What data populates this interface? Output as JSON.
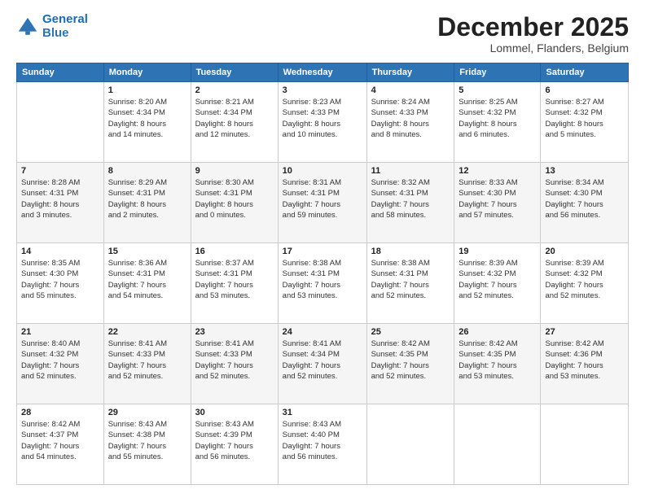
{
  "logo": {
    "line1": "General",
    "line2": "Blue"
  },
  "title": "December 2025",
  "location": "Lommel, Flanders, Belgium",
  "days_of_week": [
    "Sunday",
    "Monday",
    "Tuesday",
    "Wednesday",
    "Thursday",
    "Friday",
    "Saturday"
  ],
  "weeks": [
    [
      {
        "day": "",
        "info": ""
      },
      {
        "day": "1",
        "info": "Sunrise: 8:20 AM\nSunset: 4:34 PM\nDaylight: 8 hours\nand 14 minutes."
      },
      {
        "day": "2",
        "info": "Sunrise: 8:21 AM\nSunset: 4:34 PM\nDaylight: 8 hours\nand 12 minutes."
      },
      {
        "day": "3",
        "info": "Sunrise: 8:23 AM\nSunset: 4:33 PM\nDaylight: 8 hours\nand 10 minutes."
      },
      {
        "day": "4",
        "info": "Sunrise: 8:24 AM\nSunset: 4:33 PM\nDaylight: 8 hours\nand 8 minutes."
      },
      {
        "day": "5",
        "info": "Sunrise: 8:25 AM\nSunset: 4:32 PM\nDaylight: 8 hours\nand 6 minutes."
      },
      {
        "day": "6",
        "info": "Sunrise: 8:27 AM\nSunset: 4:32 PM\nDaylight: 8 hours\nand 5 minutes."
      }
    ],
    [
      {
        "day": "7",
        "info": "Sunrise: 8:28 AM\nSunset: 4:31 PM\nDaylight: 8 hours\nand 3 minutes."
      },
      {
        "day": "8",
        "info": "Sunrise: 8:29 AM\nSunset: 4:31 PM\nDaylight: 8 hours\nand 2 minutes."
      },
      {
        "day": "9",
        "info": "Sunrise: 8:30 AM\nSunset: 4:31 PM\nDaylight: 8 hours\nand 0 minutes."
      },
      {
        "day": "10",
        "info": "Sunrise: 8:31 AM\nSunset: 4:31 PM\nDaylight: 7 hours\nand 59 minutes."
      },
      {
        "day": "11",
        "info": "Sunrise: 8:32 AM\nSunset: 4:31 PM\nDaylight: 7 hours\nand 58 minutes."
      },
      {
        "day": "12",
        "info": "Sunrise: 8:33 AM\nSunset: 4:30 PM\nDaylight: 7 hours\nand 57 minutes."
      },
      {
        "day": "13",
        "info": "Sunrise: 8:34 AM\nSunset: 4:30 PM\nDaylight: 7 hours\nand 56 minutes."
      }
    ],
    [
      {
        "day": "14",
        "info": "Sunrise: 8:35 AM\nSunset: 4:30 PM\nDaylight: 7 hours\nand 55 minutes."
      },
      {
        "day": "15",
        "info": "Sunrise: 8:36 AM\nSunset: 4:31 PM\nDaylight: 7 hours\nand 54 minutes."
      },
      {
        "day": "16",
        "info": "Sunrise: 8:37 AM\nSunset: 4:31 PM\nDaylight: 7 hours\nand 53 minutes."
      },
      {
        "day": "17",
        "info": "Sunrise: 8:38 AM\nSunset: 4:31 PM\nDaylight: 7 hours\nand 53 minutes."
      },
      {
        "day": "18",
        "info": "Sunrise: 8:38 AM\nSunset: 4:31 PM\nDaylight: 7 hours\nand 52 minutes."
      },
      {
        "day": "19",
        "info": "Sunrise: 8:39 AM\nSunset: 4:32 PM\nDaylight: 7 hours\nand 52 minutes."
      },
      {
        "day": "20",
        "info": "Sunrise: 8:39 AM\nSunset: 4:32 PM\nDaylight: 7 hours\nand 52 minutes."
      }
    ],
    [
      {
        "day": "21",
        "info": "Sunrise: 8:40 AM\nSunset: 4:32 PM\nDaylight: 7 hours\nand 52 minutes."
      },
      {
        "day": "22",
        "info": "Sunrise: 8:41 AM\nSunset: 4:33 PM\nDaylight: 7 hours\nand 52 minutes."
      },
      {
        "day": "23",
        "info": "Sunrise: 8:41 AM\nSunset: 4:33 PM\nDaylight: 7 hours\nand 52 minutes."
      },
      {
        "day": "24",
        "info": "Sunrise: 8:41 AM\nSunset: 4:34 PM\nDaylight: 7 hours\nand 52 minutes."
      },
      {
        "day": "25",
        "info": "Sunrise: 8:42 AM\nSunset: 4:35 PM\nDaylight: 7 hours\nand 52 minutes."
      },
      {
        "day": "26",
        "info": "Sunrise: 8:42 AM\nSunset: 4:35 PM\nDaylight: 7 hours\nand 53 minutes."
      },
      {
        "day": "27",
        "info": "Sunrise: 8:42 AM\nSunset: 4:36 PM\nDaylight: 7 hours\nand 53 minutes."
      }
    ],
    [
      {
        "day": "28",
        "info": "Sunrise: 8:42 AM\nSunset: 4:37 PM\nDaylight: 7 hours\nand 54 minutes."
      },
      {
        "day": "29",
        "info": "Sunrise: 8:43 AM\nSunset: 4:38 PM\nDaylight: 7 hours\nand 55 minutes."
      },
      {
        "day": "30",
        "info": "Sunrise: 8:43 AM\nSunset: 4:39 PM\nDaylight: 7 hours\nand 56 minutes."
      },
      {
        "day": "31",
        "info": "Sunrise: 8:43 AM\nSunset: 4:40 PM\nDaylight: 7 hours\nand 56 minutes."
      },
      {
        "day": "",
        "info": ""
      },
      {
        "day": "",
        "info": ""
      },
      {
        "day": "",
        "info": ""
      }
    ]
  ]
}
